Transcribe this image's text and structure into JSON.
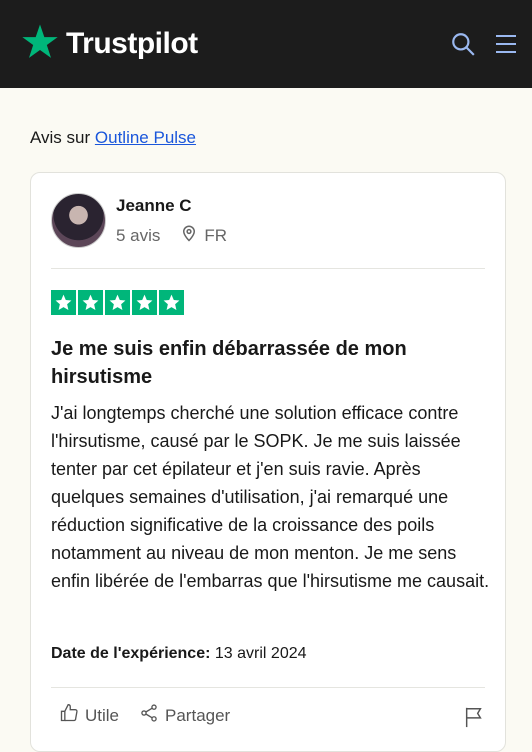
{
  "header": {
    "brand": "Trustpilot",
    "icons": [
      "star-logo-icon",
      "search-icon",
      "menu-icon"
    ],
    "brand_color": "#00b67a"
  },
  "about": {
    "prefix": "Avis sur",
    "company_link": "Outline Pulse"
  },
  "review": {
    "author": "Jeanne C",
    "review_count": "5 avis",
    "country": "FR",
    "rating": 5,
    "title": "Je me suis enfin débarrassée de mon hirsutisme",
    "body": "J'ai longtemps cherché une solution efficace contre l'hirsutisme, causé par le SOPK. Je me suis laissée tenter par cet épilateur et j'en suis ravie. Après quelques semaines d'utilisation, j'ai remarqué une réduction significative de la croissance des poils notamment au niveau de mon menton. Je me sens enfin libérée de l'embarras que l'hirsutisme me causait.",
    "date_label": "Date de l'expérience:",
    "date_value": "13 avril 2024"
  },
  "actions": {
    "useful_label": "Utile",
    "share_label": "Partager"
  }
}
